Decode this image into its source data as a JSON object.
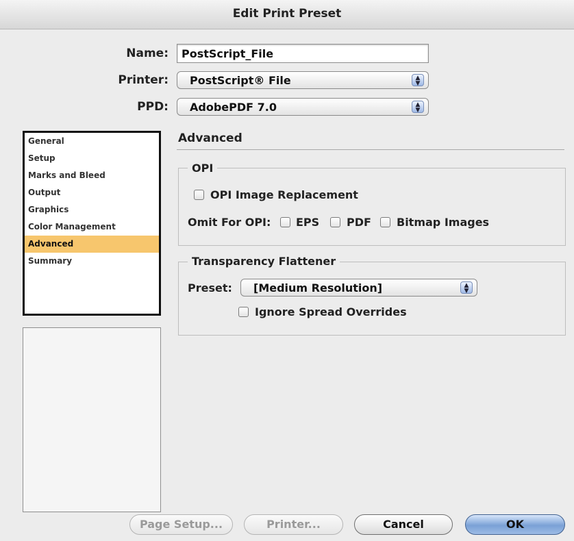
{
  "window": {
    "title": "Edit Print Preset"
  },
  "form": {
    "name_label": "Name:",
    "name_value": "PostScript_File",
    "printer_label": "Printer:",
    "printer_value": "PostScript® File",
    "ppd_label": "PPD:",
    "ppd_value": "AdobePDF 7.0"
  },
  "sidebar": {
    "items": [
      {
        "label": "General",
        "selected": false
      },
      {
        "label": "Setup",
        "selected": false
      },
      {
        "label": "Marks and Bleed",
        "selected": false
      },
      {
        "label": "Output",
        "selected": false
      },
      {
        "label": "Graphics",
        "selected": false
      },
      {
        "label": "Color Management",
        "selected": false
      },
      {
        "label": "Advanced",
        "selected": true
      },
      {
        "label": "Summary",
        "selected": false
      }
    ]
  },
  "advanced": {
    "heading": "Advanced",
    "opi": {
      "title": "OPI",
      "image_replacement_label": "OPI Image Replacement",
      "image_replacement_checked": false,
      "omit_label": "Omit For OPI:",
      "eps_label": "EPS",
      "eps_checked": false,
      "pdf_label": "PDF",
      "pdf_checked": false,
      "bitmap_label": "Bitmap Images",
      "bitmap_checked": false
    },
    "flattener": {
      "title": "Transparency Flattener",
      "preset_label": "Preset:",
      "preset_value": "[Medium Resolution]",
      "ignore_label": "Ignore Spread Overrides",
      "ignore_checked": false
    }
  },
  "buttons": {
    "page_setup": "Page Setup...",
    "printer": "Printer...",
    "cancel": "Cancel",
    "ok": "OK"
  },
  "colors": {
    "selection": "#f7c66d",
    "default_button": "#7aa1d6"
  },
  "icons": {
    "popup_arrows": "up-down-arrows-icon"
  }
}
